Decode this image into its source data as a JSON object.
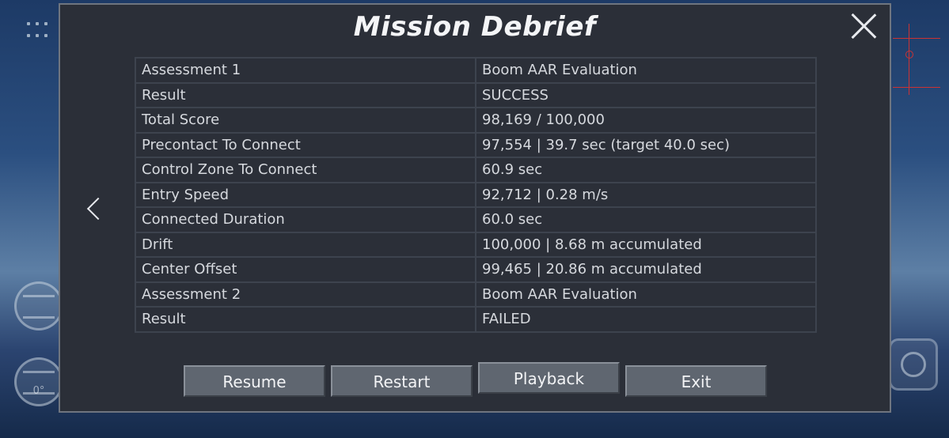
{
  "dialog": {
    "title": "Mission Debrief"
  },
  "table": {
    "rows": [
      {
        "label": "Assessment 1",
        "value": "Boom AAR Evaluation"
      },
      {
        "label": "Result",
        "value": "SUCCESS"
      },
      {
        "label": "Total Score",
        "value": "98,169 / 100,000"
      },
      {
        "label": "Precontact To Connect",
        "value": "97,554 | 39.7 sec (target 40.0 sec)"
      },
      {
        "label": "Control Zone To Connect",
        "value": "60.9 sec"
      },
      {
        "label": "Entry Speed",
        "value": "92,712 | 0.28 m/s"
      },
      {
        "label": "Connected Duration",
        "value": "60.0 sec"
      },
      {
        "label": "Drift",
        "value": "100,000 | 8.68 m accumulated"
      },
      {
        "label": "Center Offset",
        "value": "99,465 | 20.86 m accumulated"
      },
      {
        "label": "Assessment 2",
        "value": "Boom AAR Evaluation"
      },
      {
        "label": "Result",
        "value": "FAILED"
      }
    ]
  },
  "buttons": {
    "resume": "Resume",
    "restart": "Restart",
    "playback": "Playback",
    "exit": "Exit"
  },
  "hud": {
    "attitude_readout": "0°"
  },
  "icons": {
    "close": "close-icon",
    "prev": "chevron-left-icon",
    "menu": "menu-dots-icon"
  }
}
